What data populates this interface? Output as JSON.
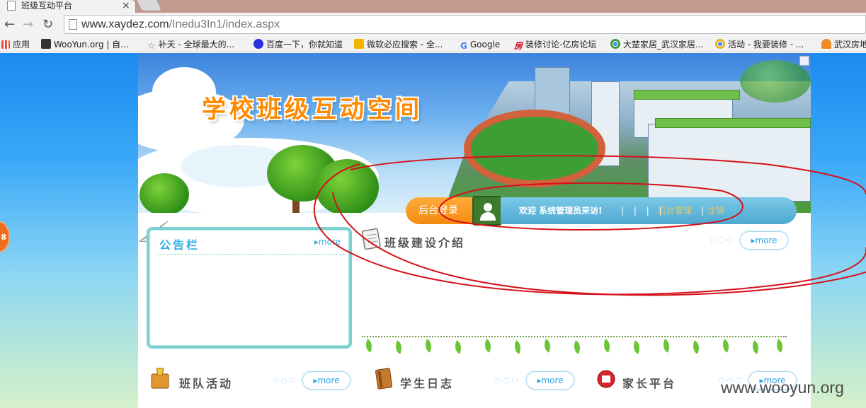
{
  "browser": {
    "tab_title": "班级互动平台",
    "tab_close": "×",
    "url_prefix": "www.xaydez.com",
    "url_path": "/Inedu3In1/index.aspx",
    "back_glyph": "←",
    "forward_glyph": "→",
    "reload_glyph": "↻"
  },
  "bookmarks": [
    {
      "label": "应用",
      "icon": "apps-grid-icon",
      "color": "#e84c3d"
    },
    {
      "label": "WooYun.org | 自...",
      "icon": "wooyun-icon",
      "color": "#333333"
    },
    {
      "label": "补天 - 全球最大的...",
      "icon": "star-icon",
      "color": "#888888"
    },
    {
      "label": "百度一下，你就知道",
      "icon": "baidu-paw-icon",
      "color": "#2932e1"
    },
    {
      "label": "微软必应搜索 - 全...",
      "icon": "bing-icon",
      "color": "#f4b400"
    },
    {
      "label": "Google",
      "icon": "google-icon",
      "color": "#4285f4"
    },
    {
      "label": "装修讨论-亿房论坛",
      "icon": "fang-icon",
      "color": "#d0021b"
    },
    {
      "label": "大楚家居_武汉家居...",
      "icon": "chrome-circle-icon",
      "color": "#3c9b3c"
    },
    {
      "label": "活动 - 我要装修 - ...",
      "icon": "chrome-circle-icon",
      "color": "#3c9b3c"
    },
    {
      "label": "武汉房地",
      "icon": "house-icon",
      "color": "#f08a24"
    }
  ],
  "side_badge": "8",
  "banner": {
    "title": "学校班级互动空间"
  },
  "login": {
    "button": "后台登录",
    "welcome": "欢迎  系统管理员来访!",
    "pipes": "| | | |",
    "admin_link": "后台管理",
    "separator": "|",
    "logout_link": "注销"
  },
  "notice": {
    "title": "公告栏",
    "more": "▸more"
  },
  "sections": {
    "class_intro": {
      "title": "班级建设介绍",
      "more": "▸more"
    },
    "team_activity": {
      "title": "班队活动",
      "more": "▸more"
    },
    "student_diary": {
      "title": "学生日志",
      "more": "▸more"
    },
    "parent_platform": {
      "title": "家长平台",
      "more": "▸more"
    }
  },
  "watermark": "www.wooyun.org",
  "colors": {
    "accent_orange": "#f38a10",
    "accent_blue": "#33aee8",
    "annotation_red": "#d6101a"
  }
}
